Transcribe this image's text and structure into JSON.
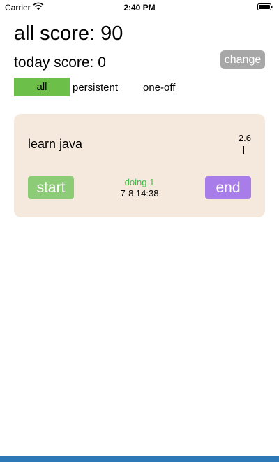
{
  "status_bar": {
    "carrier": "Carrier",
    "time": "2:40 PM",
    "icons": [
      "wifi-icon",
      "battery-icon"
    ]
  },
  "scores": {
    "all_score": "all score: 90",
    "today_score": "today score:  0",
    "change_label": "change"
  },
  "filters": {
    "all": "all",
    "persistent": "persistent",
    "one_off": "one-off",
    "selected": "all"
  },
  "task": {
    "title": "learn java",
    "points": "2.6",
    "status": "doing  1",
    "date": "7-8 14:38",
    "start_label": "start",
    "end_label": "end"
  },
  "colors": {
    "filter_active": "#6cc04a",
    "change_button": "#a7a7a7",
    "card_background": "#f5e8dc",
    "start_button": "#8dcc76",
    "end_button": "#a87de9",
    "status_text": "#42bd45",
    "bottom_bar": "#2d78b6"
  }
}
